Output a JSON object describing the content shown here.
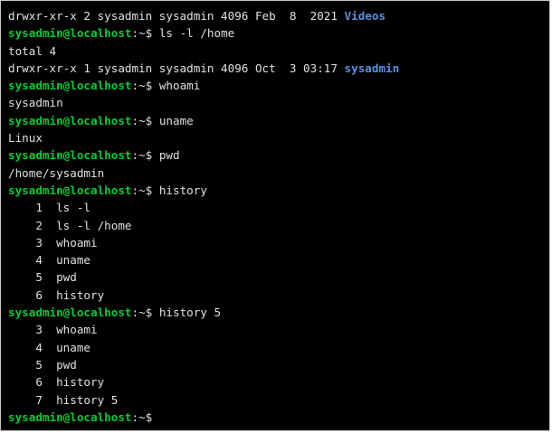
{
  "colors": {
    "background": "#000000",
    "text": "#e0e0e0",
    "prompt": "#00cc33",
    "directory": "#5c8fe0"
  },
  "terminal": {
    "prompt_user_host": "sysadmin@localhost",
    "prompt_suffix": ":~$",
    "lines": [
      {
        "type": "dir_entry",
        "prefix": "drwxr-xr-x 2 sysadmin sysadmin 4096 Feb  8  2021 ",
        "name": "Videos"
      },
      {
        "type": "command",
        "command": "ls -l /home"
      },
      {
        "type": "output",
        "text": "total 4"
      },
      {
        "type": "dir_entry",
        "prefix": "drwxr-xr-x 1 sysadmin sysadmin 4096 Oct  3 03:17 ",
        "name": "sysadmin"
      },
      {
        "type": "command",
        "command": "whoami"
      },
      {
        "type": "output",
        "text": "sysadmin"
      },
      {
        "type": "command",
        "command": "uname"
      },
      {
        "type": "output",
        "text": "Linux"
      },
      {
        "type": "command",
        "command": "pwd"
      },
      {
        "type": "output",
        "text": "/home/sysadmin"
      },
      {
        "type": "command",
        "command": "history"
      },
      {
        "type": "output",
        "text": "    1  ls -l"
      },
      {
        "type": "output",
        "text": "    2  ls -l /home"
      },
      {
        "type": "output",
        "text": "    3  whoami"
      },
      {
        "type": "output",
        "text": "    4  uname"
      },
      {
        "type": "output",
        "text": "    5  pwd"
      },
      {
        "type": "output",
        "text": "    6  history"
      },
      {
        "type": "command",
        "command": "history 5"
      },
      {
        "type": "output",
        "text": "    3  whoami"
      },
      {
        "type": "output",
        "text": "    4  uname"
      },
      {
        "type": "output",
        "text": "    5  pwd"
      },
      {
        "type": "output",
        "text": "    6  history"
      },
      {
        "type": "output",
        "text": "    7  history 5"
      },
      {
        "type": "command",
        "command": ""
      }
    ]
  }
}
